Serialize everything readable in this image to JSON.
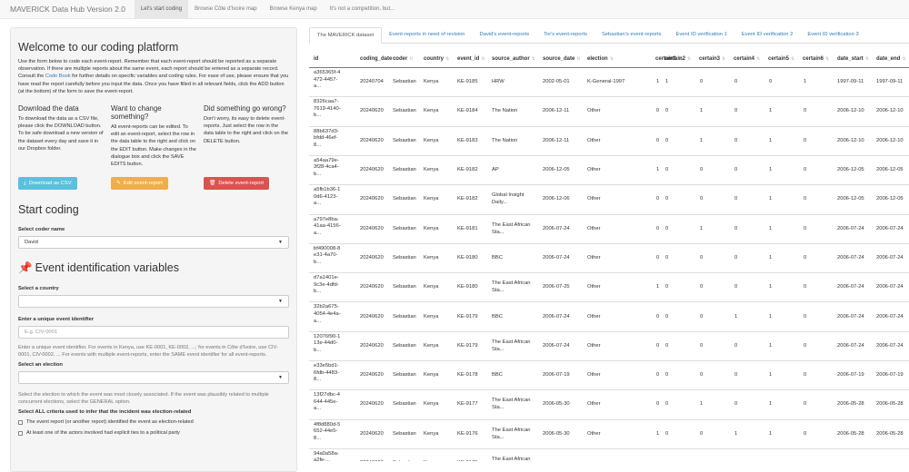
{
  "app": {
    "brand": "MAVERICK Data Hub Version 2.0",
    "nav": [
      "Let's start coding",
      "Browse Côte d'Ivoire map",
      "Browse Kenya map",
      "It's not a competition, but..."
    ]
  },
  "sidebar": {
    "welcome_title": "Welcome to our coding platform",
    "welcome_text_1": "Use the form below to code each event-report. Remember that each event-report should be reported as a separate observation. If there are multiple reports about the same event, each report should be entered as a separate record. Consult the ",
    "codebook_link": "Code Book",
    "welcome_text_2": " for further details on specific variables and coding rules. For ease of use, please ensure that you have read the report carefully before you input the data. Once you have filled in all relevant fields, click the ADD button (at the bottom) of the form to save the event-report.",
    "download_title": "Download the data",
    "download_text": "To download the data as a CSV file, please click the DOWNLOAD button. To be safe download a new version of the dataset every day and save it in our Dropbox folder.",
    "change_title": "Want to change something?",
    "change_text": "All event-reports can be edited. To edit an event-report, select the row in the data table to the right and click on the EDIT button. Make changes in the dialogue box and click the SAVE EDITS button.",
    "wrong_title": "Did something go wrong?",
    "wrong_text": "Don't worry, its easy to delete event-reports. Just select the row in the data table to the right and click on the DELETE button.",
    "btn_download": "Download as CSV",
    "btn_edit": "Edit event-report",
    "btn_delete": "Delete event-report",
    "start_title": "Start coding",
    "coder_label": "Select coder name",
    "coder_value": "David",
    "eventvars_title": "Event identification variables",
    "country_label": "Select a country",
    "country_value": "",
    "eventid_label": "Enter a unique event identifier",
    "eventid_placeholder": "E.g. CIV-0001",
    "eventid_help": "Enter a unique event identifier. For events in Kenya, use KE-0001, KE-0002, ...; for events in Côte d'Ivoire, use CIV-0001, CIV-0002, ... For events with multiple event-reports, enter the SAME event identifier for all event-reports.",
    "election_label": "Select an election",
    "election_value": "",
    "election_help": "Select the election to which the event was most closely associated. If the event was plausibly related to multiple concurrent elections, select the GENERAL option.",
    "criteria_label": "Select ALL criteria used to infer that the incident was election-related",
    "criteria": [
      "The event report (or another report) identified the event as election-related",
      "At least one of the actors involved had explicit ties to a political party"
    ]
  },
  "main": {
    "tabs": [
      "The MAVERICK dataset",
      "Event-reports in need of revision",
      "David's event-reports",
      "Tor's event-reports",
      "Sebastian's event-reports",
      "Event ID verification 1",
      "Event ID verification 2",
      "Event ID verification 3"
    ],
    "columns": [
      "id",
      "coding_date",
      "coder",
      "country",
      "event_id",
      "source_author",
      "source_date",
      "election",
      "certain1",
      "certain2",
      "certain3",
      "certain4",
      "certain5",
      "certain6",
      "date_start",
      "date_end"
    ],
    "rows": [
      [
        "a365365f-4472-4457-a...",
        "20240704",
        "Sebastian",
        "Kenya",
        "KE-9185",
        "HRW",
        "2002-05-01",
        "K-General-1997",
        "1",
        "1",
        "0",
        "0",
        "0",
        "1",
        "1997-09-11",
        "1997-09-11"
      ],
      [
        "8326caa7-7619-4140-b...",
        "20240620",
        "Sebastian",
        "Kenya",
        "KE-9184",
        "The Nation",
        "2006-12-11",
        "Other",
        "0",
        "0",
        "1",
        "0",
        "1",
        "0",
        "2006-12-10",
        "2006-12-10"
      ],
      [
        "88b637d3-bfdd-46ef-8...",
        "20240620",
        "Sebastian",
        "Kenya",
        "KE-9183",
        "The Nation",
        "2006-12-11",
        "Other",
        "0",
        "0",
        "1",
        "0",
        "1",
        "0",
        "2006-12-10",
        "2006-12-10"
      ],
      [
        "a54aa79e-3f28-4ca4-b...",
        "20240620",
        "Sebastian",
        "Kenya",
        "KE-9182",
        "AP",
        "2006-12-05",
        "Other",
        "1",
        "0",
        "0",
        "0",
        "1",
        "0",
        "2006-12-05",
        "2006-12-05"
      ],
      [
        "a5fb1b36-10d6-4123-a...",
        "20240620",
        "Sebastian",
        "Kenya",
        "KE-9182",
        "Global Insight Daily...",
        "2006-12-06",
        "Other",
        "0",
        "0",
        "0",
        "0",
        "1",
        "0",
        "2006-12-05",
        "2006-12-05"
      ],
      [
        "a797e8ba-41aa-4156-a...",
        "20240620",
        "Sebastian",
        "Kenya",
        "KE-9181",
        "The East African Sta...",
        "2006-07-24",
        "Other",
        "0",
        "0",
        "1",
        "0",
        "1",
        "0",
        "2006-07-24",
        "2006-07-24"
      ],
      [
        "bf490008-8e31-4a70-b...",
        "20240620",
        "Sebastian",
        "Kenya",
        "KE-9180",
        "BBC",
        "2006-07-24",
        "Other",
        "0",
        "0",
        "0",
        "0",
        "1",
        "0",
        "2006-07-24",
        "2006-07-24"
      ],
      [
        "d7a1401e-9c3e-4dfd-b...",
        "20240620",
        "Sebastian",
        "Kenya",
        "KE-9180",
        "The East African Sta...",
        "2006-07-25",
        "Other",
        "1",
        "0",
        "0",
        "0",
        "1",
        "0",
        "2006-07-24",
        "2006-07-24"
      ],
      [
        "32b2a675-4054-4e4a-a...",
        "20240620",
        "Sebastian",
        "Kenya",
        "KE-9179",
        "BBC",
        "2006-07-24",
        "Other",
        "0",
        "0",
        "0",
        "1",
        "1",
        "0",
        "2006-07-24",
        "2006-07-24"
      ],
      [
        "12076f90-113e-44d0-b...",
        "20240620",
        "Sebastian",
        "Kenya",
        "KE-9179",
        "The East African Sta...",
        "2006-07-24",
        "Other",
        "0",
        "0",
        "0",
        "0",
        "1",
        "0",
        "2006-07-24",
        "2006-07-24"
      ],
      [
        "e33e5bd1-6fdb-4483-8...",
        "20240620",
        "Sebastian",
        "Kenya",
        "KE-9178",
        "BBC",
        "2006-07-19",
        "Other",
        "0",
        "0",
        "0",
        "0",
        "1",
        "0",
        "2006-07-19",
        "2006-07-19"
      ],
      [
        "13f27dbc-4644-445e-a...",
        "20240620",
        "Sebastian",
        "Kenya",
        "KE-9177",
        "The East African Sta...",
        "2006-05-30",
        "Other",
        "0",
        "0",
        "1",
        "0",
        "1",
        "0",
        "2006-05-28",
        "2006-05-28"
      ],
      [
        "4f8d880d-5652-44e5-8...",
        "20240620",
        "Sebastian",
        "Kenya",
        "KE-9176",
        "The East African Sta...",
        "2006-05-30",
        "Other",
        "1",
        "0",
        "0",
        "1",
        "1",
        "0",
        "2006-05-28",
        "2006-05-28"
      ],
      [
        "94a0a58a-a2fe-...",
        "20240620",
        "Sebastian",
        "Kenya",
        "KE-9175",
        "The East African Sta...",
        "",
        "",
        "",
        "",
        "",
        "",
        "",
        "",
        "",
        ""
      ]
    ]
  }
}
